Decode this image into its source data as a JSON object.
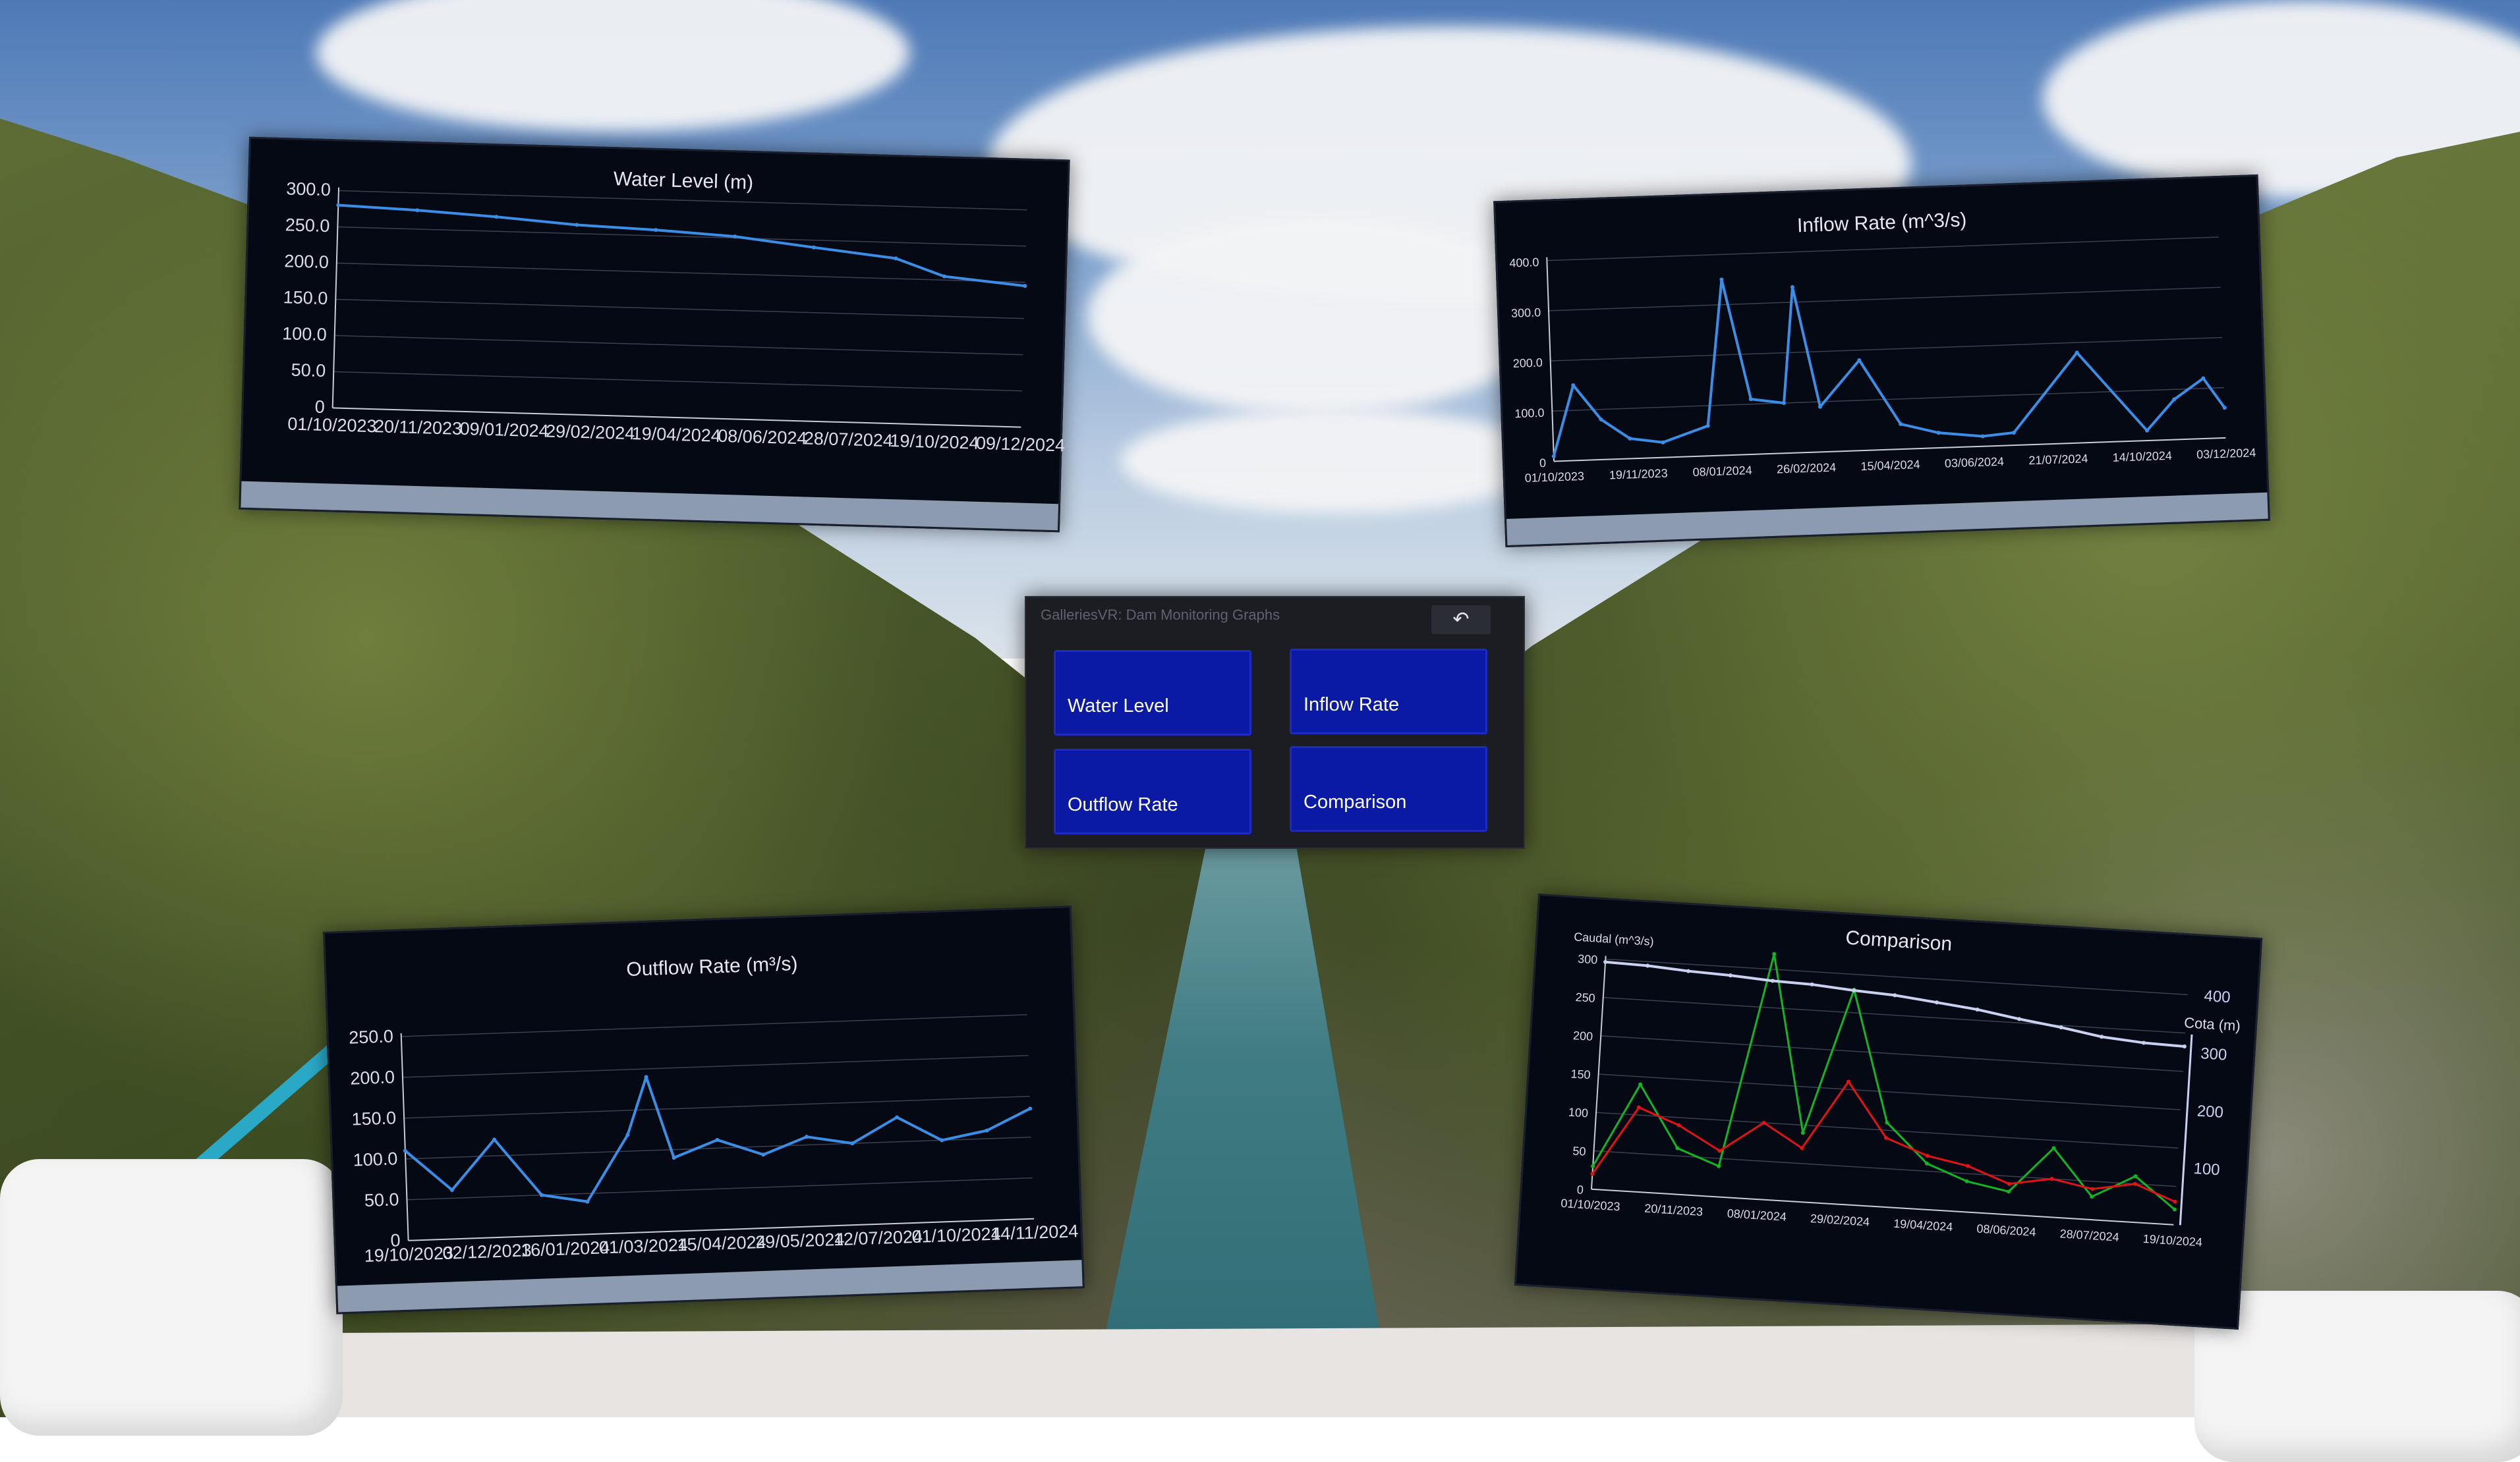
{
  "menu": {
    "title": "GalleriesVR: Dam Monitoring Graphs",
    "back_icon": "↶",
    "buttons": [
      "Water Level",
      "Inflow Rate",
      "Outflow Rate",
      "Comparison"
    ]
  },
  "colors": {
    "series_blue": "#3a8ee6",
    "comparison_red": "#e01414",
    "comparison_green": "#12b523",
    "comparison_line": "#c8d2f0"
  },
  "chart_data": [
    {
      "type": "line",
      "title": "Water Level (m)",
      "ylim": [
        0,
        300
      ],
      "yticks": [
        "300.0",
        "250.0",
        "200.0",
        "150.0",
        "100.0",
        "50.0",
        "0"
      ],
      "xticks": [
        "01/10/2023",
        "20/11/2023",
        "09/01/2024",
        "29/02/2024",
        "19/04/2024",
        "08/06/2024",
        "28/07/2024",
        "19/10/2024",
        "09/12/2024"
      ],
      "x": [
        "01/10/2023",
        "20/11/2023",
        "09/01/2024",
        "29/02/2024",
        "19/04/2024",
        "08/06/2024",
        "28/07/2024",
        "18/09/2024",
        "19/10/2024",
        "09/12/2024"
      ],
      "values": [
        280,
        276,
        270,
        262,
        258,
        252,
        240,
        228,
        205,
        195
      ]
    },
    {
      "type": "line",
      "title": "Inflow Rate (m^3/s)",
      "ylim": [
        0,
        400
      ],
      "yticks": [
        "400.0",
        "300.0",
        "200.0",
        "100.0",
        "0"
      ],
      "xticks": [
        "01/10/2023",
        "19/11/2023",
        "08/01/2024",
        "26/02/2024",
        "15/04/2024",
        "03/06/2024",
        "21/07/2024",
        "14/10/2024",
        "03/12/2024"
      ],
      "x": [
        "01/10/2023",
        "15/10/2023",
        "01/11/2023",
        "19/11/2023",
        "10/12/2023",
        "08/01/2024",
        "20/01/2024",
        "05/02/2024",
        "26/02/2024",
        "05/03/2024",
        "20/03/2024",
        "15/04/2024",
        "10/05/2024",
        "03/06/2024",
        "01/07/2024",
        "21/07/2024",
        "01/09/2024",
        "14/10/2024",
        "01/11/2024",
        "20/11/2024",
        "03/12/2024"
      ],
      "values": [
        10,
        150,
        80,
        40,
        30,
        60,
        350,
        110,
        100,
        330,
        90,
        180,
        50,
        30,
        20,
        25,
        180,
        20,
        80,
        120,
        60
      ]
    },
    {
      "type": "line",
      "title": "Outflow Rate (m³/s)",
      "ylim": [
        0,
        250
      ],
      "yticks": [
        "250.0",
        "200.0",
        "150.0",
        "100.0",
        "50.0",
        "0"
      ],
      "xticks": [
        "19/10/2023",
        "02/12/2023",
        "16/01/2024",
        "01/03/2024",
        "15/04/2024",
        "29/05/2024",
        "12/07/2024",
        "01/10/2024",
        "14/11/2024"
      ],
      "x": [
        "01/10/2023",
        "01/11/2023",
        "01/12/2023",
        "01/01/2024",
        "01/02/2024",
        "01/03/2024",
        "15/03/2024",
        "01/04/2024",
        "01/05/2024",
        "01/06/2024",
        "01/07/2024",
        "01/08/2024",
        "01/09/2024",
        "01/10/2024",
        "01/11/2024",
        "01/12/2024"
      ],
      "values": [
        110,
        60,
        120,
        50,
        40,
        120,
        190,
        90,
        110,
        90,
        110,
        100,
        130,
        100,
        110,
        135
      ]
    },
    {
      "type": "line",
      "title": "Comparison",
      "ylabel": "Caudal (m^3/s)",
      "y2label": "Cota (m)",
      "ylim": [
        0,
        300
      ],
      "y2lim": [
        0,
        400
      ],
      "yticks": [
        "300",
        "250",
        "200",
        "150",
        "100",
        "50",
        "0"
      ],
      "y2ticks": [
        "400",
        "300",
        "200",
        "100"
      ],
      "xticks": [
        "01/10/2023",
        "20/11/2023",
        "08/01/2024",
        "29/02/2024",
        "19/04/2024",
        "08/06/2024",
        "28/07/2024",
        "19/10/2024"
      ],
      "x": [
        "01/10/2023",
        "01/11/2023",
        "01/12/2023",
        "01/01/2024",
        "01/02/2024",
        "01/03/2024",
        "01/04/2024",
        "01/05/2024",
        "01/06/2024",
        "01/07/2024",
        "01/08/2024",
        "01/09/2024",
        "01/10/2024",
        "01/11/2024",
        "01/12/2024"
      ],
      "series": [
        {
          "values": [
            30,
            140,
            60,
            40,
            320,
            90,
            280,
            110,
            60,
            40,
            30,
            90,
            30,
            60,
            20
          ]
        },
        {
          "values": [
            20,
            110,
            90,
            60,
            100,
            70,
            160,
            90,
            70,
            60,
            40,
            50,
            40,
            50,
            30
          ]
        },
        {
          "values": [
            395,
            393,
            388,
            385,
            380,
            378,
            372,
            368,
            360,
            352,
            340,
            330,
            318,
            312,
            310
          ]
        }
      ]
    }
  ]
}
